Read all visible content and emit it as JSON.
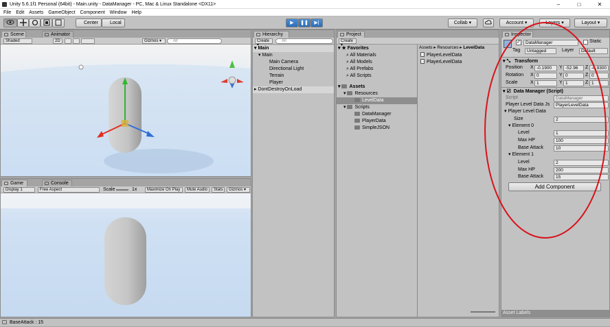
{
  "window": {
    "title": "Unity 5.6.1f1 Personal (64bit) - Main.unity - DataManager - PC, Mac & Linux Standalone <DX11>",
    "minimize": "–",
    "maximize": "□",
    "close": "✕"
  },
  "menu": [
    "File",
    "Edit",
    "Assets",
    "GameObject",
    "Component",
    "Window",
    "Help"
  ],
  "toolbar": {
    "center": "Center",
    "local": "Local",
    "collab": "Collab ▾",
    "account": "Account ▾",
    "layers": "Layers ▾",
    "layout": "Layout ▾",
    "play_icon": "▶",
    "pause_icon": "❚❚",
    "step_icon": "▶|"
  },
  "scene": {
    "tabs": [
      "Scene",
      "Animator"
    ],
    "shading": "Shaded",
    "mode_2d": "2D",
    "gizmos": "Gizmos ▾",
    "search_placeholder": "All"
  },
  "game": {
    "tabs": [
      "Game",
      "Console"
    ],
    "display": "Display 1",
    "aspect": "Free Aspect",
    "scale_label": "Scale",
    "scale_value": "1x",
    "maximize": "Maximize On Play",
    "mute": "Mute Audio",
    "stats": "Stats",
    "gizmos": "Gizmos ▾"
  },
  "hierarchy": {
    "tab": "Hierarchy",
    "create": "Create ▾",
    "search_placeholder": "All",
    "scene_main": "Main",
    "items": [
      "Main",
      "Main Camera",
      "Directional Light",
      "Terrain",
      "Player"
    ],
    "scene_dontdestroy": "DontDestroyOnLoad"
  },
  "project": {
    "tab": "Project",
    "create": "Create ▾",
    "favorites": "Favorites",
    "fav_items": [
      "All Materials",
      "All Models",
      "All Prefabs",
      "All Scripts"
    ],
    "assets": "Assets",
    "tree": [
      "Resources",
      "LevelData",
      "Scripts",
      "DataManager",
      "PlayerData",
      "SimpleJSON"
    ],
    "breadcrumb": [
      "Assets",
      "Resources",
      "LevelData"
    ],
    "files": [
      "PlayerLevelData",
      "PlayerLevelData"
    ]
  },
  "inspector": {
    "tab": "Inspector",
    "object_name": "DataManager",
    "static": "Static",
    "tag_label": "Tag",
    "tag_value": "Untagged",
    "layer_label": "Layer",
    "layer_value": "Default",
    "transform": {
      "title": "Transform",
      "position_label": "Position",
      "rotation_label": "Rotation",
      "scale_label": "Scale",
      "position": [
        "-0.1900",
        "-52.96",
        "-0.9300"
      ],
      "rotation": [
        "0",
        "0",
        "0"
      ],
      "scale": [
        "1",
        "1",
        "1"
      ]
    },
    "script_comp": {
      "title": "Data Manager (Script)",
      "script_label": "Script",
      "script_value": "DataManager",
      "pld_label": "Player Level Data Js",
      "pld_value": "PlayerLevelData",
      "list_label": "Player Level Data",
      "size_label": "Size",
      "size_value": "2",
      "elements": [
        {
          "label": "Element 0",
          "level": "1",
          "max_hp": "100",
          "base_attack": "10"
        },
        {
          "label": "Element 1",
          "level": "2",
          "max_hp": "200",
          "base_attack": "15"
        }
      ],
      "level_label": "Level",
      "maxhp_label": "Max HP",
      "baseattack_label": "Base Attack"
    },
    "add_component": "Add Component",
    "asset_labels": "Asset Labels"
  },
  "status": {
    "text": "BaseAttack : 15"
  },
  "colors": {
    "annotation_circle": "#d8121a",
    "play_blue": "#2f6fbb"
  }
}
